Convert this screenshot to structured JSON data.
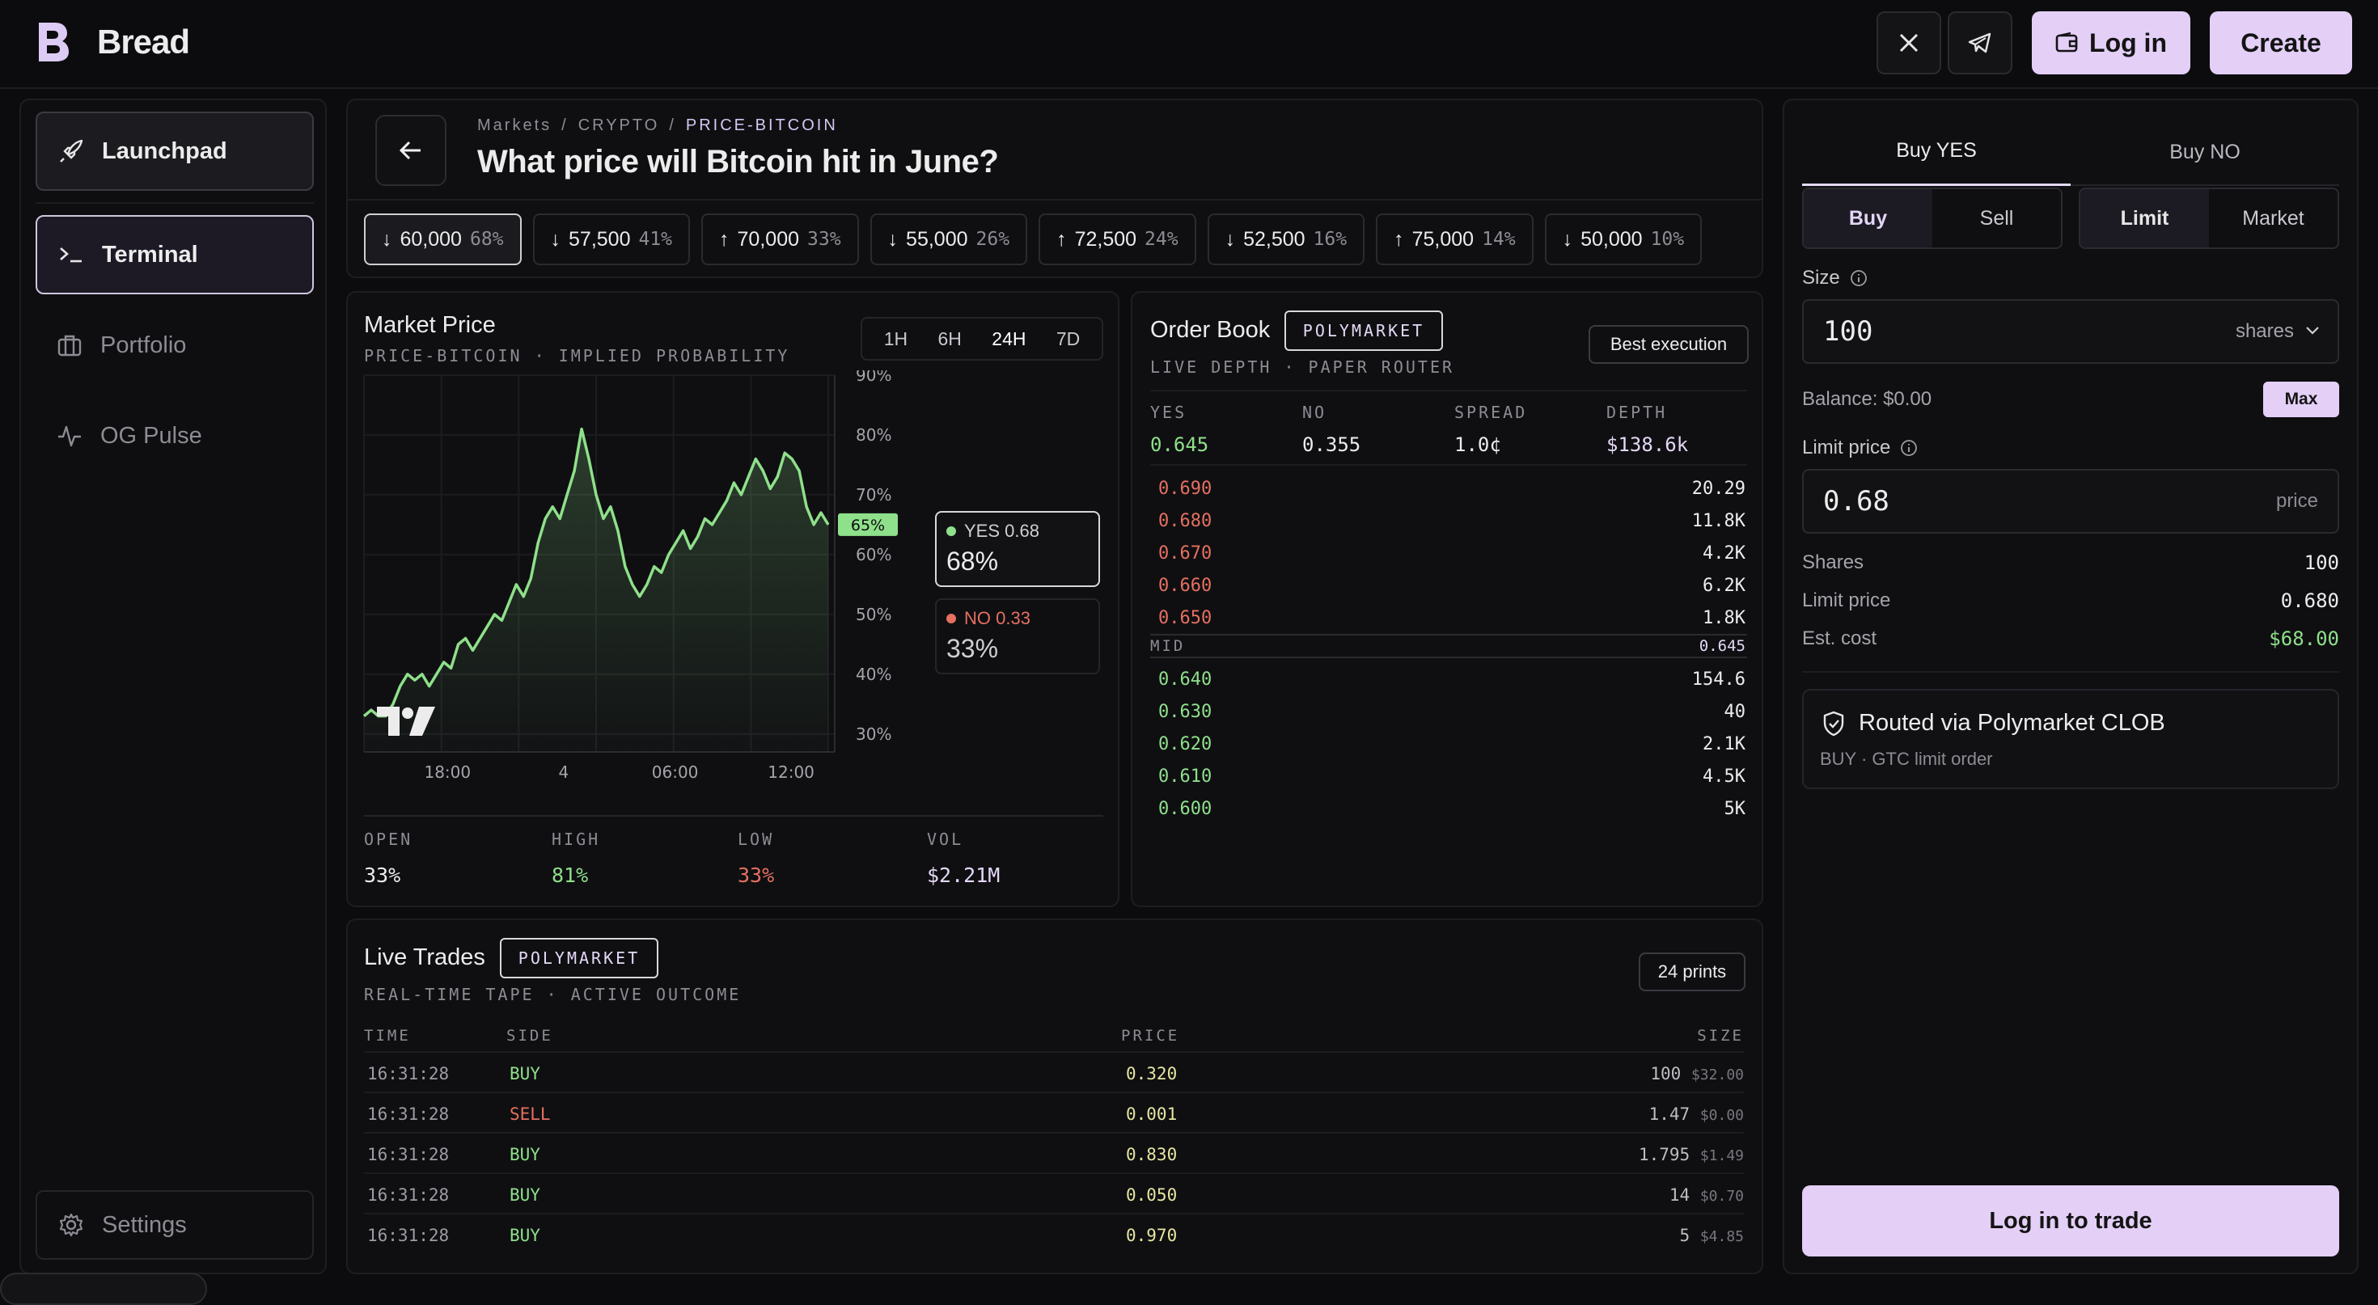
{
  "app": {
    "name": "Bread"
  },
  "header": {
    "login_label": "Log in",
    "create_label": "Create"
  },
  "sidebar": {
    "items": [
      {
        "label": "Launchpad",
        "icon": "rocket-icon"
      },
      {
        "label": "Terminal",
        "icon": "terminal-icon"
      },
      {
        "label": "Portfolio",
        "icon": "briefcase-icon"
      },
      {
        "label": "OG Pulse",
        "icon": "pulse-icon"
      }
    ],
    "settings_label": "Settings"
  },
  "market": {
    "breadcrumb": [
      "Markets",
      "CRYPTO",
      "PRICE-BITCOIN"
    ],
    "title": "What price will Bitcoin hit in June?",
    "outcomes": [
      {
        "dir": "↓",
        "label": "60,000",
        "pct": "68%"
      },
      {
        "dir": "↓",
        "label": "57,500",
        "pct": "41%"
      },
      {
        "dir": "↑",
        "label": "70,000",
        "pct": "33%"
      },
      {
        "dir": "↓",
        "label": "55,000",
        "pct": "26%"
      },
      {
        "dir": "↑",
        "label": "72,500",
        "pct": "24%"
      },
      {
        "dir": "↓",
        "label": "52,500",
        "pct": "16%"
      },
      {
        "dir": "↑",
        "label": "75,000",
        "pct": "14%"
      },
      {
        "dir": "↓",
        "label": "50,000",
        "pct": "10%"
      }
    ]
  },
  "price_chart": {
    "title": "Market Price",
    "subtitle": "PRICE-BITCOIN · IMPLIED PROBABILITY",
    "timeframes": [
      "1H",
      "6H",
      "24H",
      "7D"
    ],
    "active_timeframe": "24H",
    "current_tag": "65%",
    "yes_label": "YES 0.68",
    "yes_pct": "68%",
    "no_label": "NO 0.33",
    "no_pct": "33%",
    "stats": [
      {
        "label": "OPEN",
        "value": "33%"
      },
      {
        "label": "HIGH",
        "value": "81%"
      },
      {
        "label": "LOW",
        "value": "33%"
      },
      {
        "label": "VOL",
        "value": "$2.21M"
      }
    ]
  },
  "chart_data": {
    "type": "area",
    "title": "Market Price",
    "subtitle": "PRICE-BITCOIN · IMPLIED PROBABILITY",
    "x_ticks": [
      "18:00",
      "4",
      "06:00",
      "12:00"
    ],
    "y_ticks": [
      "90%",
      "80%",
      "70%",
      "60%",
      "50%",
      "40%",
      "30%"
    ],
    "ylim": [
      27,
      90
    ],
    "grid": true,
    "series": [
      {
        "values": [
          33,
          34,
          33,
          33,
          35,
          38,
          40,
          39,
          40,
          38,
          40,
          42,
          41,
          45,
          46,
          44,
          46,
          48,
          50,
          49,
          52,
          55,
          53,
          56,
          62,
          66,
          68,
          66,
          70,
          74,
          81,
          76,
          70,
          66,
          68,
          64,
          58,
          55,
          53,
          55,
          58,
          57,
          60,
          62,
          64,
          61,
          63,
          66,
          65,
          67,
          69,
          72,
          70,
          73,
          76,
          74,
          71,
          73,
          77,
          76,
          74,
          68,
          65,
          67,
          65
        ]
      }
    ]
  },
  "order_book": {
    "title": "Order Book",
    "badge": "POLYMARKET",
    "subtitle": "LIVE DEPTH · PAPER ROUTER",
    "best_label": "Best execution",
    "summary": [
      {
        "label": "YES",
        "value": "0.645"
      },
      {
        "label": "NO",
        "value": "0.355"
      },
      {
        "label": "SPREAD",
        "value": "1.0¢"
      },
      {
        "label": "DEPTH",
        "value": "$138.6k"
      }
    ],
    "asks": [
      {
        "price": "0.690",
        "size": "20.29"
      },
      {
        "price": "0.680",
        "size": "11.8K"
      },
      {
        "price": "0.670",
        "size": "4.2K"
      },
      {
        "price": "0.660",
        "size": "6.2K"
      },
      {
        "price": "0.650",
        "size": "1.8K"
      }
    ],
    "mid_label": "MID",
    "mid_value": "0.645",
    "bids": [
      {
        "price": "0.640",
        "size": "154.6"
      },
      {
        "price": "0.630",
        "size": "40"
      },
      {
        "price": "0.620",
        "size": "2.1K"
      },
      {
        "price": "0.610",
        "size": "4.5K"
      },
      {
        "price": "0.600",
        "size": "5K"
      }
    ],
    "colors": {
      "ask": "#e5705f",
      "bid": "#8fe08a"
    }
  },
  "live_trades": {
    "title": "Live Trades",
    "badge": "POLYMARKET",
    "subtitle": "REAL-TIME TAPE · ACTIVE OUTCOME",
    "prints_label": "24 prints",
    "columns": [
      "TIME",
      "SIDE",
      "PRICE",
      "SIZE"
    ],
    "rows": [
      {
        "time": "16:31:28",
        "side": "BUY",
        "price": "0.320",
        "size": "100",
        "usd": "$32.00"
      },
      {
        "time": "16:31:28",
        "side": "SELL",
        "price": "0.001",
        "size": "1.47",
        "usd": "$0.00"
      },
      {
        "time": "16:31:28",
        "side": "BUY",
        "price": "0.830",
        "size": "1.795",
        "usd": "$1.49"
      },
      {
        "time": "16:31:28",
        "side": "BUY",
        "price": "0.050",
        "size": "14",
        "usd": "$0.70"
      },
      {
        "time": "16:31:28",
        "side": "BUY",
        "price": "0.970",
        "size": "5",
        "usd": "$4.85"
      }
    ]
  },
  "trade_panel": {
    "tabs": [
      "Buy YES",
      "Buy NO"
    ],
    "side_options": [
      "Buy",
      "Sell"
    ],
    "order_types": [
      "Limit",
      "Market"
    ],
    "size_label": "Size",
    "size_value": "100",
    "size_unit": "shares",
    "balance_label": "Balance: $0.00",
    "max_label": "Max",
    "limit_label": "Limit price",
    "limit_value": "0.68",
    "limit_unit": "price",
    "summary": [
      {
        "label": "Shares",
        "value": "100"
      },
      {
        "label": "Limit price",
        "value": "0.680"
      },
      {
        "label": "Est. cost",
        "value": "$68.00"
      }
    ],
    "route_title": "Routed via Polymarket CLOB",
    "route_sub": "BUY · GTC limit order",
    "cta_label": "Log in to trade"
  },
  "colors": {
    "accent": "#e4cff7",
    "green": "#8fe08a",
    "red": "#e5705f"
  }
}
